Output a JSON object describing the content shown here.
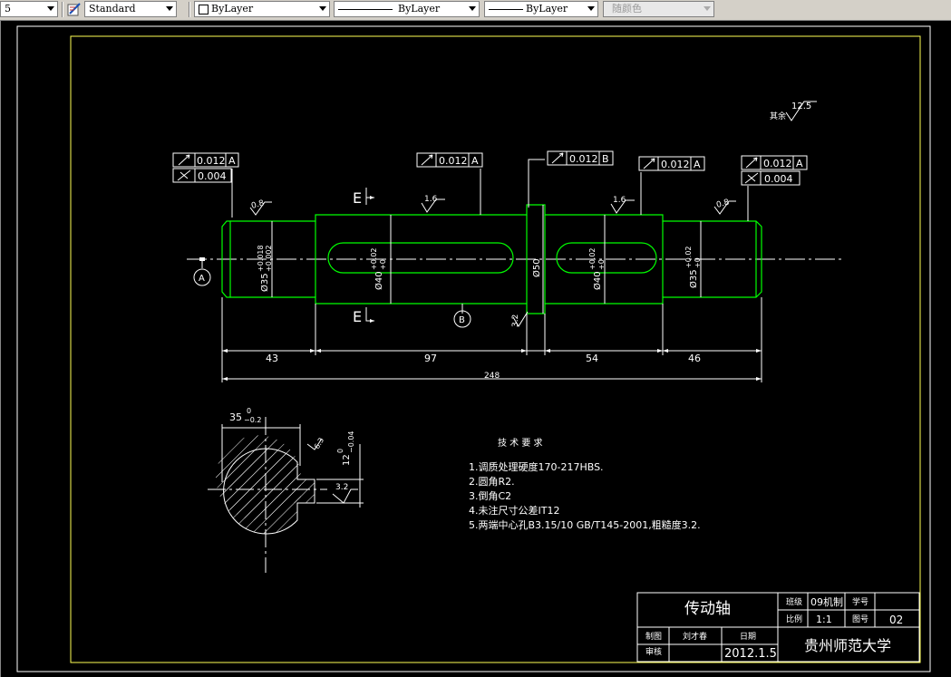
{
  "toolbar": {
    "first_value": "5",
    "text_style": "Standard",
    "layer_label": "ByLayer",
    "linetype_label": "ByLayer",
    "lineweight_label": "ByLayer",
    "color_label": "随颜色"
  },
  "drawing": {
    "roughness_other": "其余",
    "roughness_other_value": "12.5",
    "tol_values": {
      "a": "0.012",
      "b": "0.004"
    },
    "datum_a": "A",
    "datum_b": "B",
    "section_mark": "E",
    "rough_left": "0.8",
    "rough_mid1": "1.6",
    "rough_mid2": "1.6",
    "rough_right": "0.8",
    "rough_shoulder": "3.2",
    "dia_d1": "Ø35",
    "dia_d1_tol_up": "+0.018",
    "dia_d1_tol_low": "+0.002",
    "dia_d2": "Ø40",
    "dia_d2_tol_up": "+0.02",
    "dia_d2_tol_low": "+0",
    "dia_d3": "Ø50",
    "dia_d4": "Ø40",
    "dia_d4_tol_up": "+0.02",
    "dia_d4_tol_low": "+0",
    "dia_d5": "Ø35",
    "dia_d5_tol_up": "+0.02",
    "dia_d5_tol_low": "+0",
    "len_1": "43",
    "len_2": "97",
    "len_3": "54",
    "len_4": "46",
    "len_total": "248",
    "sec_dim_top": "35",
    "sec_dim_top_up": "0",
    "sec_dim_top_low": "−0.2",
    "sec_dim_side": "12",
    "sec_dim_side_up": "0",
    "sec_dim_side_low": "−0.04",
    "sec_rough_1": "6.3",
    "sec_rough_2": "3.2",
    "tech_title": "技 术 要 求",
    "tech_items": [
      "1.调质处理硬度170-217HBS.",
      "2.圆角R2.",
      "3.倒角C2",
      "4.未注尺寸公差IT12",
      "5.两端中心孔B3.15/10  GB/T145-2001,粗糙度3.2."
    ]
  },
  "title_block": {
    "part_name": "传动轴",
    "class_label": "班级",
    "class_value": "09机制",
    "student_no_label": "学号",
    "scale_label": "比例",
    "scale_value": "1:1",
    "drawing_no_label": "图号",
    "drawing_no_value": "02",
    "drawn_label": "制图",
    "drawn_by": "刘才春",
    "date_label": "日期",
    "checked_label": "审核",
    "date_value": "2012.1.5",
    "school": "贵州师范大学"
  }
}
